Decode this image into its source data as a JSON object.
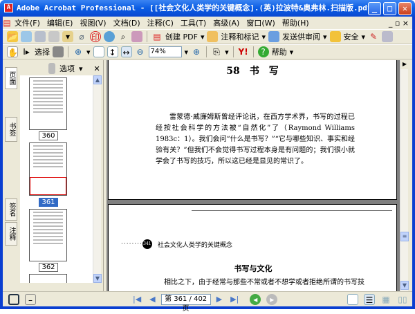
{
  "window": {
    "title": "Adobe Acrobat Professional - [[社会文化人类学的关键概念].(英)拉波特&奥弗林.扫描版.pdf]"
  },
  "menu": [
    "文件(F)",
    "编辑(E)",
    "视图(V)",
    "文档(D)",
    "注释(C)",
    "工具(T)",
    "高级(A)",
    "窗口(W)",
    "帮助(H)"
  ],
  "toolbar1": {
    "create_pdf": "创建 PDF",
    "comment_markup": "注释和标记",
    "send_review": "发送供审阅",
    "security": "安全"
  },
  "toolbar2": {
    "select": "选择",
    "zoom": "74%",
    "help": "帮助"
  },
  "panel": {
    "options": "选项",
    "tabs": [
      "页面",
      "书签",
      "签名",
      "注释"
    ],
    "thumbnails": [
      "360",
      "361",
      "362"
    ],
    "selected": "361"
  },
  "page1": {
    "header": "58　书　写",
    "paragraph": "雷蒙德·威廉姆斯曾经评论说，在西方学术界，书写的过程已经按社会科学的方法被“自然化”了（Raymond Williams 1983c：1）。我们会问“什么是书写？”“它与哪些知识、事实和经验有关？”但我们不会觉得书写过程本身是有问题的；我们很小就学会了书写的技巧，所以这已经是显见的常识了。"
  },
  "page2": {
    "page_no": "341",
    "running_head": "社会文化人类学的关键概念",
    "heading": "书写与文化",
    "first_line": "相比之下，由于经常与那些不常或者不想学或者拒绝所谓的书写技"
  },
  "status": {
    "page_indicator": "第 361 / 402 页"
  }
}
